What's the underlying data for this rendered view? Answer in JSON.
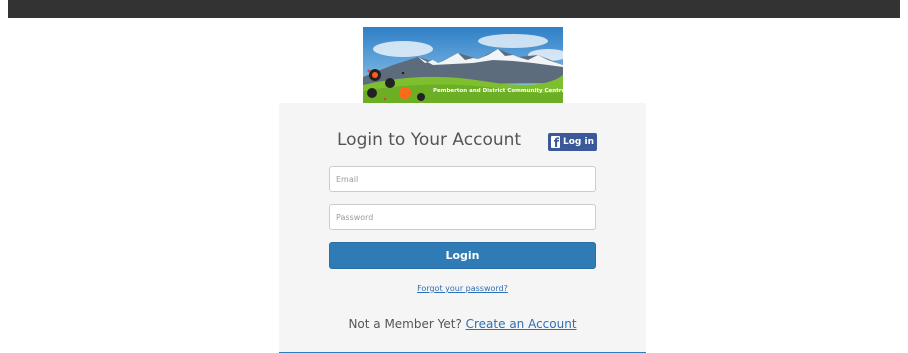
{
  "banner": {
    "caption": "Pemberton and District Community Centre"
  },
  "login": {
    "title": "Login to Your Account",
    "facebook_label": "Log in",
    "email_placeholder": "Email",
    "password_placeholder": "Password",
    "submit_label": "Login",
    "forgot_link": "Forgot your password?",
    "member_prompt": "Not a Member Yet? ",
    "create_link": "Create an Account"
  },
  "colors": {
    "topbar": "#333333",
    "panel_bg": "#f5f5f5",
    "primary": "#2f7bb5",
    "facebook": "#3b5998",
    "link": "#2f6fb5"
  }
}
